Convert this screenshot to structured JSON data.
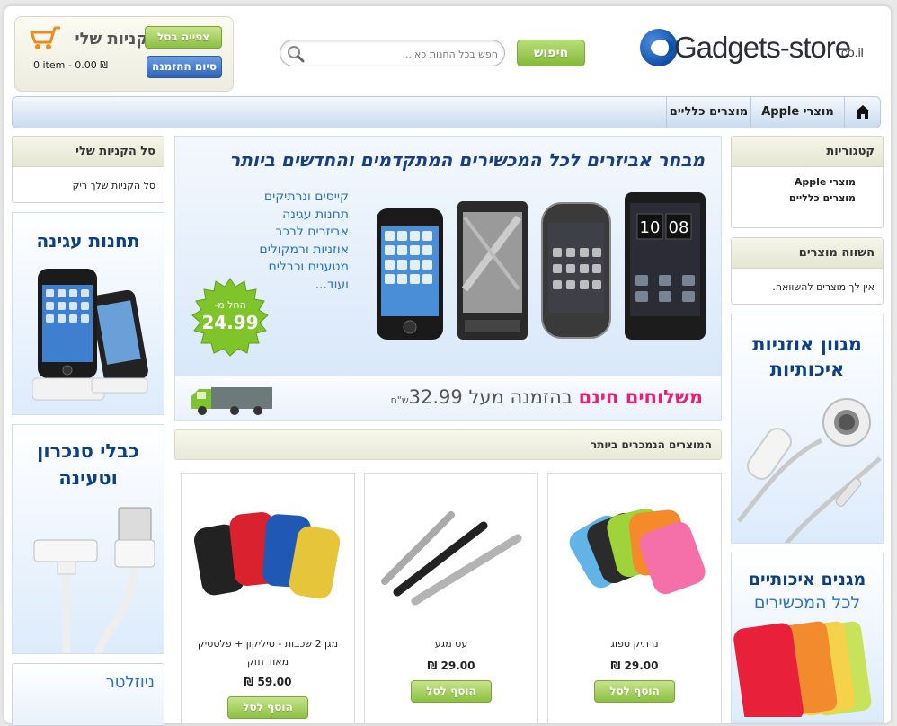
{
  "header": {
    "logo_text": "Gadgets-store",
    "logo_tld": ".co.il",
    "search_button": "חיפוש",
    "search_placeholder": "חפש בכל החנות כאן...",
    "cart_title": "הקניות שלי",
    "cart_view_button": "צפייה בסל",
    "cart_checkout_button": "סיום ההזמנה",
    "cart_summary": "0 item - 0.00 ₪"
  },
  "nav": {
    "items": [
      {
        "label": "מוצרי Apple"
      },
      {
        "label": "מוצרים כלליים"
      }
    ]
  },
  "sidebar_left": {
    "cart_box_title": "סל הקניות שלי",
    "cart_box_body": "סל הקניות שלך ריק",
    "banner1": "תחנות עגינה",
    "banner2_line1": "כבלי סנכרון",
    "banner2_line2": "וטעינה",
    "newsletter_title": "ניוזלטר"
  },
  "sidebar_right": {
    "categories_title": "קטגוריות",
    "categories": [
      "מוצרי Apple",
      "מוצרים כלליים"
    ],
    "compare_title": "השווה מוצרים",
    "compare_body": "אין לך מוצרים להשוואה.",
    "banner1_line1": "מגוון אוזניות",
    "banner1_line2": "איכותיות",
    "banner2_line1": "מגנים איכותיים",
    "banner2_line2": "לכל המכשירים"
  },
  "hero": {
    "title": "מבחר אביזרים לכל המכשירים המתקדמים והחדשים ביותר",
    "list": [
      "קייסים ונרתיקים",
      "תחנות עגינה",
      "אביזרים לרכב",
      "אוזניות ורמקולים",
      "מטענים וכבלים",
      "ועוד..."
    ],
    "price_from_label": "החל מ-",
    "price_from": "24.99",
    "free_shipping_bold": "משלוחים חינם",
    "free_shipping_rest": " בהזמנה מעל 32.99",
    "currency_word": "ש\"ח"
  },
  "bestsellers": {
    "title": "המוצרים הנמכרים ביותר",
    "add_to_cart": "הוסף לסל",
    "products": [
      {
        "name": "נרתיק ספוג",
        "price": "29.00 ₪"
      },
      {
        "name": "עט מגע",
        "price": "29.00 ₪"
      },
      {
        "name": "מגן 2 שכבות - סיליקון + פלסטיק מאוד חזק",
        "price": "59.00 ₪"
      }
    ]
  }
}
